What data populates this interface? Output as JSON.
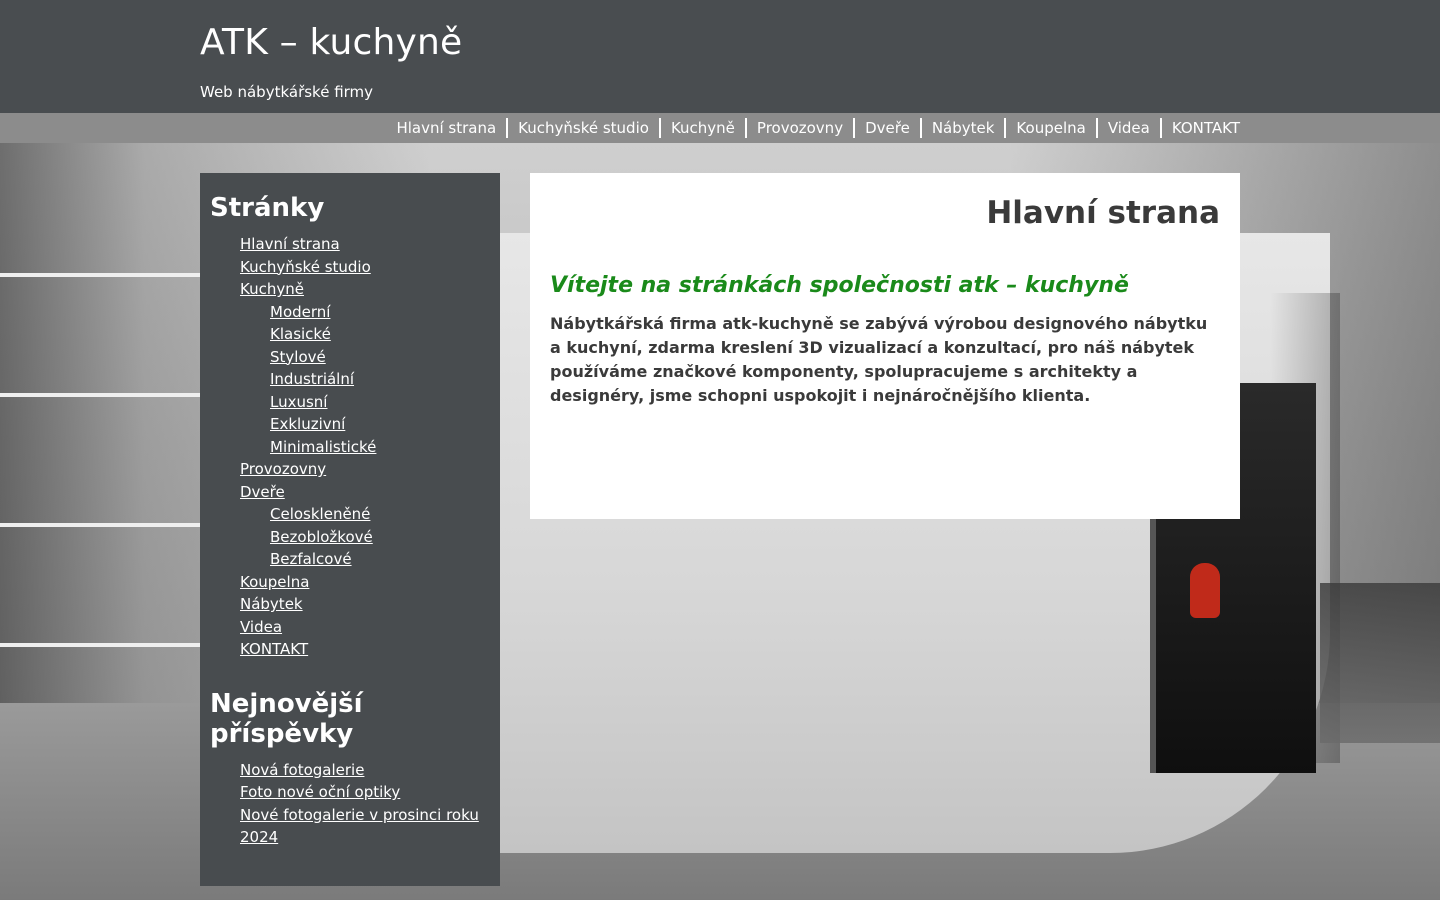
{
  "site": {
    "title": "ATK – kuchyně",
    "description": "Web nábytkářské firmy"
  },
  "nav": {
    "items": [
      {
        "label": "Hlavní strana"
      },
      {
        "label": "Kuchyňské studio"
      },
      {
        "label": "Kuchyně"
      },
      {
        "label": "Provozovny"
      },
      {
        "label": "Dveře"
      },
      {
        "label": "Nábytek"
      },
      {
        "label": "Koupelna"
      },
      {
        "label": "Videa"
      },
      {
        "label": "KONTAKT"
      }
    ]
  },
  "sidebar": {
    "pages_heading": "Stránky",
    "pages": [
      {
        "label": "Hlavní strana"
      },
      {
        "label": "Kuchyňské studio"
      },
      {
        "label": "Kuchyně",
        "children": [
          {
            "label": "Moderní"
          },
          {
            "label": "Klasické"
          },
          {
            "label": "Stylové"
          },
          {
            "label": "Industriální"
          },
          {
            "label": "Luxusní"
          },
          {
            "label": "Exkluzivní"
          },
          {
            "label": "Minimalistické"
          }
        ]
      },
      {
        "label": "Provozovny"
      },
      {
        "label": "Dveře",
        "children": [
          {
            "label": "Celoskleněné"
          },
          {
            "label": "Bezobložkové"
          },
          {
            "label": "Bezfalcové"
          }
        ]
      },
      {
        "label": "Koupelna"
      },
      {
        "label": "Nábytek"
      },
      {
        "label": "Videa"
      },
      {
        "label": "KONTAKT"
      }
    ],
    "posts_heading": "Nejnovější příspěvky",
    "posts": [
      {
        "label": "Nová fotogalerie"
      },
      {
        "label": "Foto nové oční optiky"
      },
      {
        "label": "Nové fotogalerie v prosinci roku 2024"
      }
    ]
  },
  "main": {
    "page_title": "Hlavní strana",
    "welcome": "Vítejte na stránkách společnosti atk – kuchyně",
    "intro": "Nábytkářská firma atk-kuchyně se zabývá výrobou designového nábytku a kuchyní, zdarma kreslení 3D vizualizací a konzultací, pro náš nábytek používáme značkové komponenty, spolupracujeme s architekty a designéry, jsme schopni uspokojit i nejnáročnějšího klienta."
  },
  "colors": {
    "header_bg": "#494d50",
    "sidebar_bg": "#484c4f",
    "welcome_green": "#1a8a1a",
    "text_dark": "#3a3a3a"
  }
}
